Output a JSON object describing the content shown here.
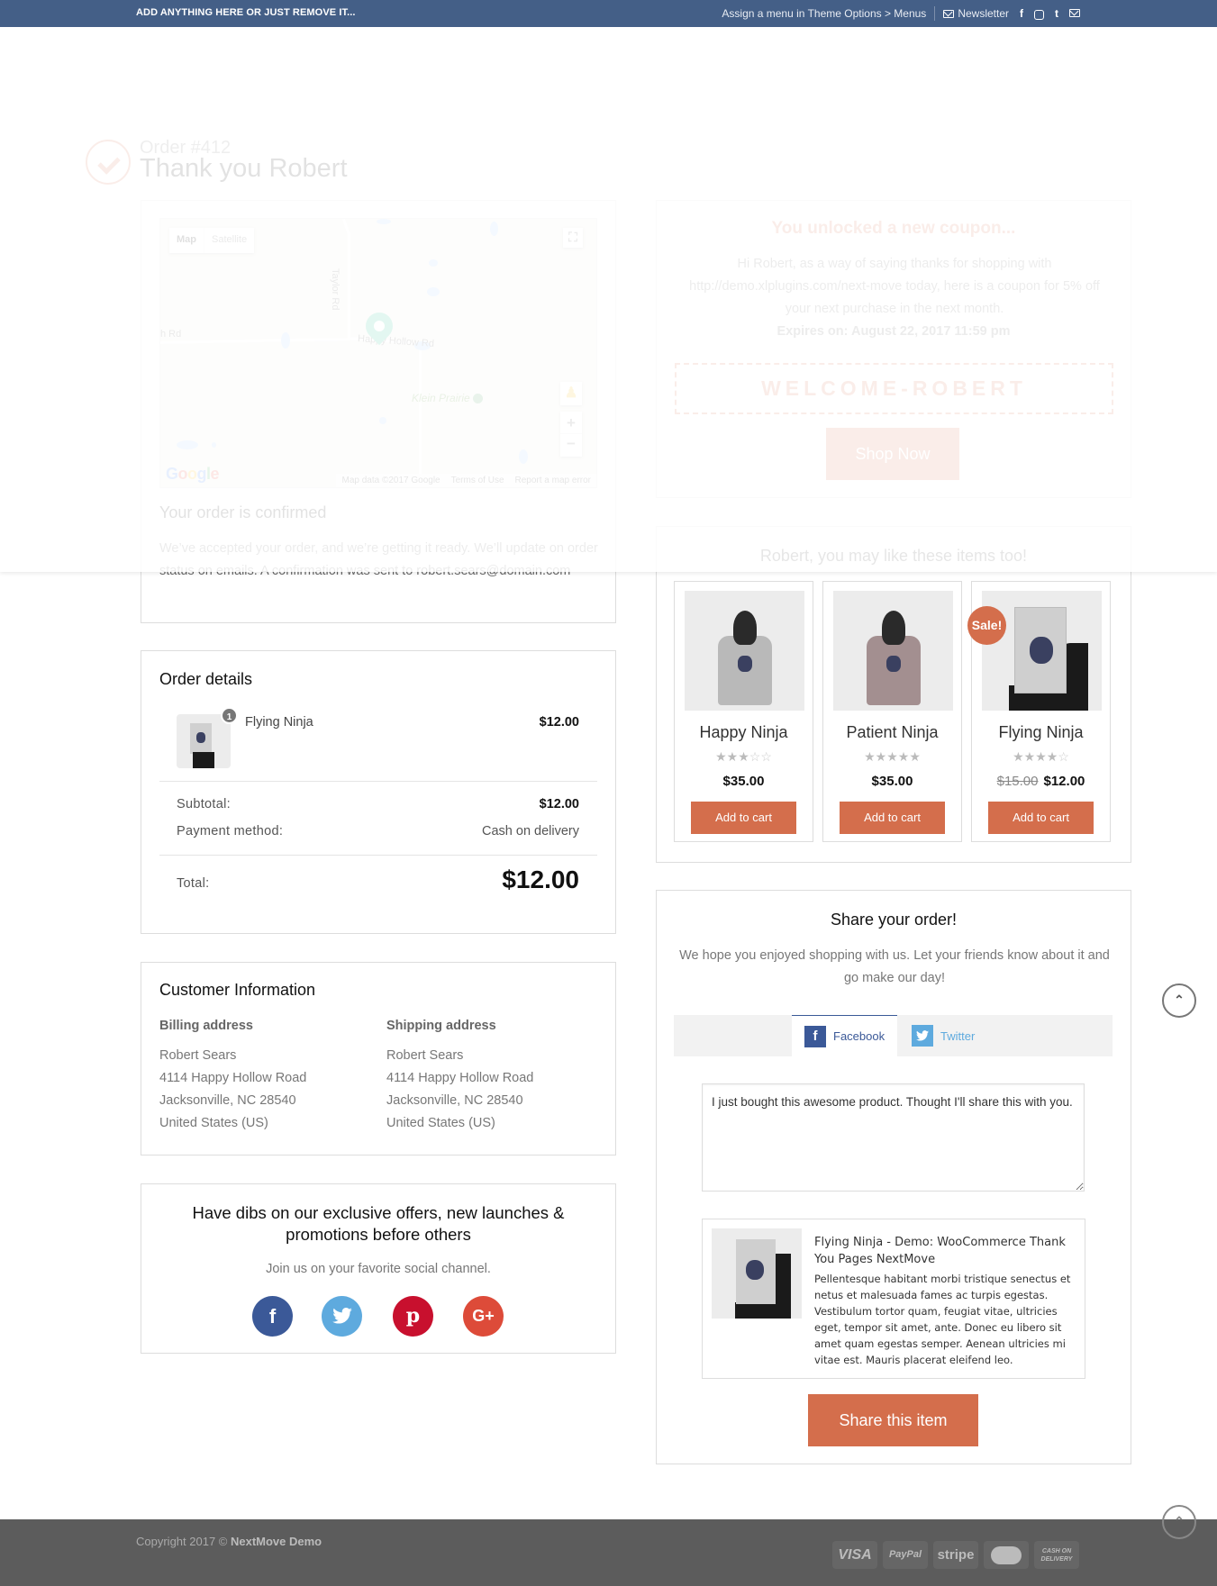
{
  "topbar": {
    "left_text": "ADD ANYTHING HERE OR JUST REMOVE IT...",
    "menu_text": "Assign a menu in Theme Options > Menus",
    "newsletter": "Newsletter",
    "social_icons": [
      "facebook-icon",
      "instagram-icon",
      "twitter-icon",
      "email-icon"
    ]
  },
  "header": {
    "order_number": "Order #412",
    "thank_you": "Thank you Robert"
  },
  "map": {
    "type_map": "Map",
    "type_satellite": "Satellite",
    "labels": {
      "taylor_rd": "Taylor Rd",
      "happy_hollow": "Happy Hollow Rd",
      "left_rd": "h Rd",
      "klein": "Klein Prairie"
    },
    "google": "Google",
    "attribution": [
      "Map data ©2017 Google",
      "Terms of Use",
      "Report a map error"
    ],
    "zoom_in": "+",
    "zoom_out": "−"
  },
  "confirmation": {
    "title": "Your order is confirmed",
    "text": "We’ve accepted your order, and we’re getting it ready. We’ll update on order status on emails. A confirmation was sent to robert.sears@domain.com"
  },
  "order_details": {
    "title": "Order details",
    "items": [
      {
        "name": "Flying Ninja",
        "qty": "1",
        "price": "$12.00"
      }
    ],
    "subtotal_label": "Subtotal:",
    "subtotal": "$12.00",
    "payment_label": "Payment method:",
    "payment": "Cash on delivery",
    "total_label": "Total:",
    "total": "$12.00"
  },
  "customer": {
    "title": "Customer Information",
    "billing": {
      "label": "Billing address",
      "lines": [
        "Robert Sears",
        "4114 Happy Hollow Road",
        "Jacksonville, NC 28540",
        "United States (US)"
      ]
    },
    "shipping": {
      "label": "Shipping address",
      "lines": [
        "Robert Sears",
        "4114 Happy Hollow Road",
        "Jacksonville, NC 28540",
        "United States (US)"
      ]
    }
  },
  "social_join": {
    "title": "Have dibs on our exclusive offers, new launches & promotions before others",
    "subtitle": "Join us on your favorite social channel.",
    "channels": [
      {
        "name": "facebook",
        "glyph": "f",
        "color": "#3b5998"
      },
      {
        "name": "twitter",
        "glyph": "t",
        "color": "#5eaade"
      },
      {
        "name": "pinterest",
        "glyph": "p",
        "color": "#c8102e"
      },
      {
        "name": "google-plus",
        "glyph": "G+",
        "color": "#dd4b39"
      }
    ]
  },
  "coupon": {
    "title": "You unlocked a new coupon...",
    "text": "Hi Robert, as a way of saying thanks for shopping with http://demo.xlplugins.com/next-move today, here is a coupon for 5% off your next purchase in the next month.",
    "expires": "Expires on: August 22, 2017 11:59 pm",
    "code": "WELCOME-ROBERT",
    "button": "Shop Now"
  },
  "recommend": {
    "title": "Robert, you may like these items too!",
    "products": [
      {
        "name": "Happy Ninja",
        "rating": 3,
        "rating_max": 5,
        "price": "$35.00",
        "old_price": null,
        "sale": false,
        "button": "Add to cart"
      },
      {
        "name": "Patient Ninja",
        "rating": 4.5,
        "rating_max": 5,
        "price": "$35.00",
        "old_price": null,
        "sale": false,
        "button": "Add to cart"
      },
      {
        "name": "Flying Ninja",
        "rating": 4,
        "rating_max": 5,
        "price": "$12.00",
        "old_price": "$15.00",
        "sale": true,
        "sale_label": "Sale!",
        "button": "Add to cart"
      }
    ]
  },
  "share": {
    "title": "Share your order!",
    "text": "We hope you enjoyed shopping with us. Let your friends know about it and go make our day!",
    "tabs": [
      {
        "label": "Facebook",
        "active": true
      },
      {
        "label": "Twitter",
        "active": false
      }
    ],
    "message": "I just bought this awesome product. Thought I'll share this with you.",
    "preview_title": "Flying Ninja - Demo: WooCommerce Thank You Pages NextMove",
    "preview_desc": "Pellentesque habitant morbi tristique senectus et netus et malesuada fames ac turpis egestas. Vestibulum tortor quam, feugiat vitae, ultricies eget, tempor sit amet, ante. Donec eu libero sit amet quam egestas semper. Aenean ultricies mi vitae est. Mauris placerat eleifend leo.",
    "button": "Share this item"
  },
  "footer": {
    "copyright_prefix": "Copyright 2017 ©",
    "brand": "NextMove Demo",
    "payments": [
      "VISA",
      "PayPal",
      "stripe",
      "MasterCard",
      "CASH ON DELIVERY"
    ]
  },
  "colors": {
    "accent": "#d46e4c",
    "topbar": "#445f87",
    "footer": "#5c5c5c"
  }
}
